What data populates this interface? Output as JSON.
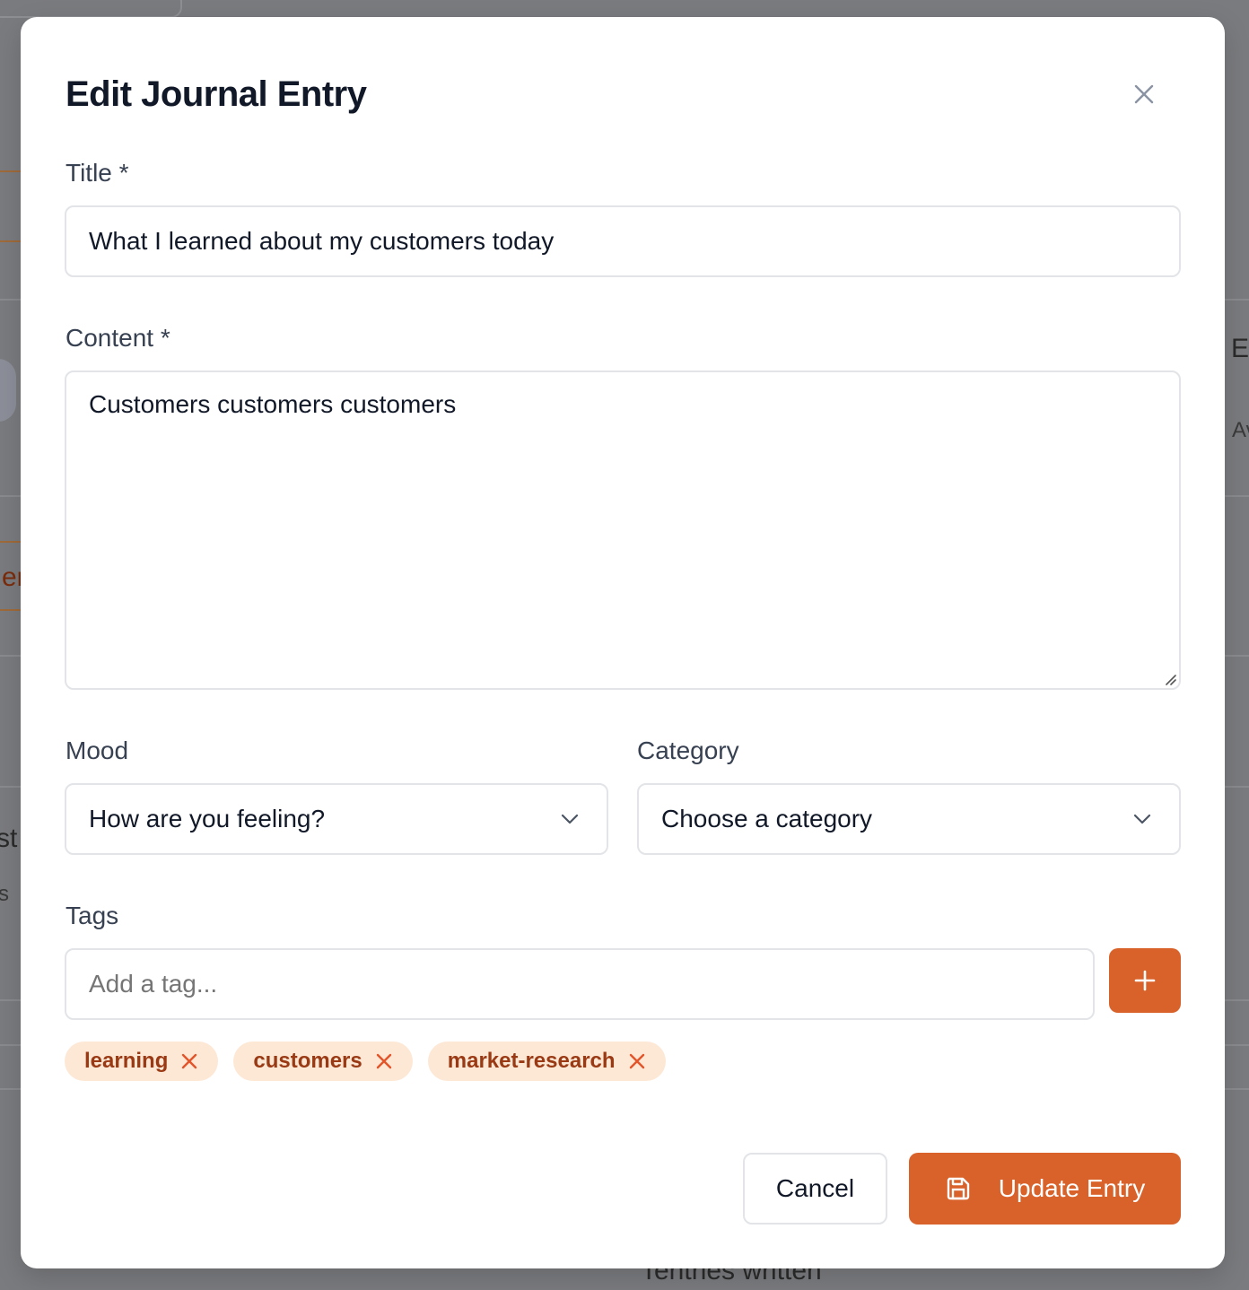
{
  "background": {
    "fragments": {
      "left_a": "er",
      "left_b": "st",
      "left_c": "s",
      "right_a": "E",
      "right_b": "Av",
      "bottom": "Tentries written"
    }
  },
  "modal": {
    "title": "Edit Journal Entry",
    "close_icon": "close-icon"
  },
  "form": {
    "title_label": "Title *",
    "title_value": "What I learned about my customers today",
    "content_label": "Content *",
    "content_value": "Customers customers customers",
    "mood_label": "Mood",
    "mood_value": "How are you feeling?",
    "category_label": "Category",
    "category_value": "Choose a category",
    "tags_label": "Tags",
    "tag_input_placeholder": "Add a tag...",
    "tags": [
      "learning",
      "customers",
      "market-research"
    ]
  },
  "actions": {
    "cancel_label": "Cancel",
    "update_label": "Update Entry"
  },
  "colors": {
    "accent": "#d9622b",
    "tag_bg": "#fde8d6",
    "tag_text": "#9a3a14",
    "overlay": "#7a7b7e"
  }
}
